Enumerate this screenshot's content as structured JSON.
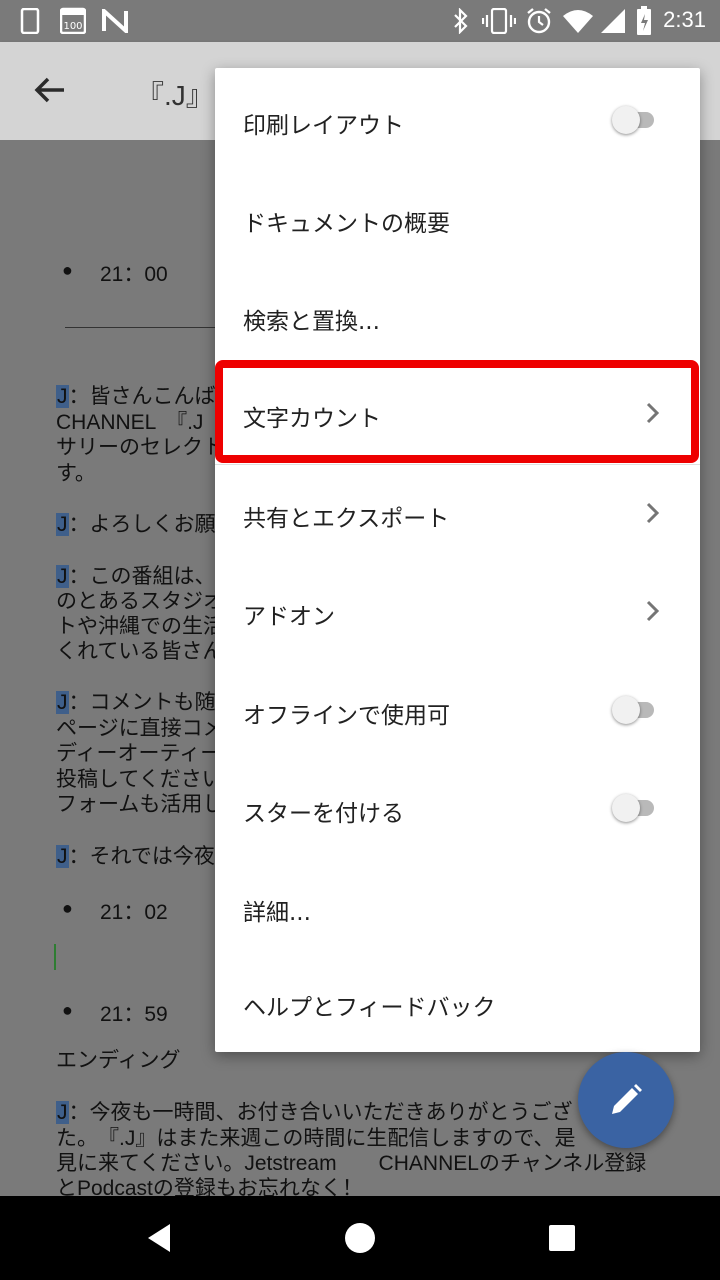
{
  "status_bar": {
    "time": "2:31",
    "icons": [
      "phone-icon",
      "calendar-100-icon",
      "n-icon",
      "bluetooth-icon",
      "vibrate-icon",
      "alarm-icon",
      "wifi-icon",
      "signal-icon",
      "battery-icon"
    ],
    "calendar_label": "100"
  },
  "app_bar": {
    "title": "『.J』台"
  },
  "document": {
    "lines": [
      {
        "type": "bullet",
        "text": "21：00"
      },
      {
        "type": "para",
        "speaker": "J",
        "text": "：皆さんこんば"
      },
      {
        "type": "plain",
        "text": "CHANNEL　『.J"
      },
      {
        "type": "plain",
        "text": "サリーのセレクト"
      },
      {
        "type": "plain",
        "text": "す。"
      },
      {
        "type": "para",
        "speaker": "J",
        "text": "：よろしくお願"
      },
      {
        "type": "para",
        "speaker": "J",
        "text": "：この番組は、"
      },
      {
        "type": "plain",
        "text": "のとあるスタジオ"
      },
      {
        "type": "plain",
        "text": "トや沖縄での生活"
      },
      {
        "type": "plain",
        "text": "くれている皆さん"
      },
      {
        "type": "para",
        "speaker": "J",
        "text": "：コメントも随"
      },
      {
        "type": "plain",
        "text": "ページに直接コメ"
      },
      {
        "type": "plain",
        "text": "ディーオーティー"
      },
      {
        "type": "plain",
        "text": "投稿してください"
      },
      {
        "type": "plain",
        "text": "フォームも活用し"
      },
      {
        "type": "para",
        "speaker": "J",
        "text": "：それでは今夜"
      },
      {
        "type": "bullet",
        "text": "21：02"
      },
      {
        "type": "bullet",
        "text": "21：59"
      },
      {
        "type": "plain",
        "text": "エンディング"
      },
      {
        "type": "para",
        "speaker": "J",
        "text": "：今夜も一時間、お付き合いいただきありがとうござ"
      },
      {
        "type": "plain",
        "text": "た。　『.J』はまた来週この時間に生配信しますので、是"
      },
      {
        "type": "plain",
        "text": "見に来てください。Jetstream　　CHANNELのチャンネル登録"
      },
      {
        "type": "plain",
        "text": "とPodcastの登録もお忘れなく！"
      }
    ]
  },
  "menu": {
    "items": [
      {
        "label": "印刷レイアウト",
        "control": "toggle",
        "toggle_on": false
      },
      {
        "label": "ドキュメントの概要",
        "control": "none"
      },
      {
        "label": "検索と置換...",
        "control": "none"
      },
      {
        "label": "文字カウント",
        "control": "chevron",
        "highlighted": true
      },
      {
        "label": "共有とエクスポート",
        "control": "chevron"
      },
      {
        "label": "アドオン",
        "control": "chevron"
      },
      {
        "label": "オフラインで使用可",
        "control": "toggle",
        "toggle_on": false
      },
      {
        "label": "スターを付ける",
        "control": "toggle",
        "toggle_on": false
      },
      {
        "label": "詳細...",
        "control": "none"
      },
      {
        "label": "ヘルプとフィードバック",
        "control": "none"
      }
    ]
  },
  "colors": {
    "highlight_border": "#ee0000",
    "fab": "#3a63a3",
    "selection": "#3f5f8a"
  },
  "fab": {
    "icon": "pencil-icon"
  },
  "nav_bar": {
    "icons": [
      "back-triangle-icon",
      "home-circle-icon",
      "recents-square-icon"
    ]
  }
}
